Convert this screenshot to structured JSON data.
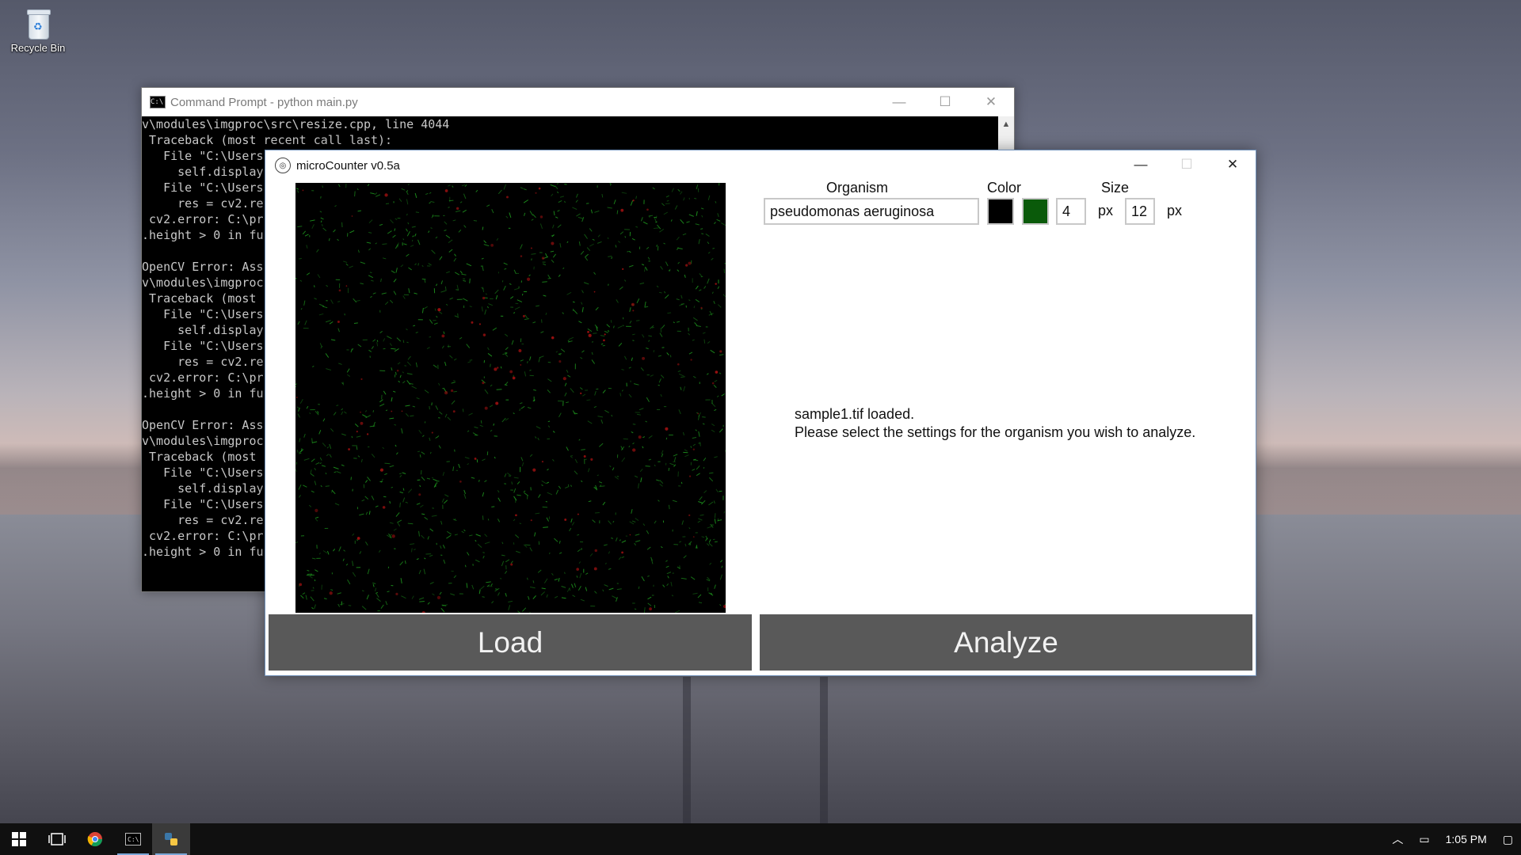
{
  "desktop": {
    "icons": [
      {
        "label": "Recycle Bin",
        "icon": "recycle-bin-icon"
      }
    ]
  },
  "cmd_window": {
    "title": "Command Prompt - python  main.py",
    "lines": [
      "v\\modules\\imgproc\\src\\resize.cpp, line 4044",
      " Traceback (most recent call last):",
      "   File \"C:\\Users",
      "     self.display",
      "   File \"C:\\Users",
      "     res = cv2.re",
      " cv2.error: C:\\pr",
      ".height > 0 in fu",
      "",
      "OpenCV Error: Ass",
      "v\\modules\\imgproc",
      " Traceback (most ",
      "   File \"C:\\Users",
      "     self.display",
      "   File \"C:\\Users",
      "     res = cv2.re",
      " cv2.error: C:\\pr",
      ".height > 0 in fu",
      "",
      "OpenCV Error: Ass",
      "v\\modules\\imgproc",
      " Traceback (most ",
      "   File \"C:\\Users",
      "     self.display",
      "   File \"C:\\Users",
      "     res = cv2.re",
      " cv2.error: C:\\pr",
      ".height > 0 in fu"
    ]
  },
  "app_window": {
    "title": "microCounter v0.5a",
    "headers": {
      "organism": "Organism",
      "color": "Color",
      "size": "Size"
    },
    "organism_value": "pseudomonas aeruginosa",
    "colors": {
      "swatch1": "#000000",
      "swatch2": "#0a5a0a",
      "image_bg": "#000000",
      "dot_green": "#1f9a1f",
      "dot_red": "#9a1010"
    },
    "color_width_value": "4",
    "color_unit": "px",
    "size_value": "12",
    "size_unit": "px",
    "status_lines": [
      "sample1.tif loaded.",
      "Please select the settings for the organism you wish to analyze."
    ],
    "load_label": "Load",
    "analyze_label": "Analyze"
  },
  "taskbar": {
    "items": [
      "start-icon",
      "task-view-icon",
      "chrome-icon",
      "cmd-icon",
      "python-icon"
    ],
    "tray": {
      "time": "1:05 PM"
    }
  }
}
